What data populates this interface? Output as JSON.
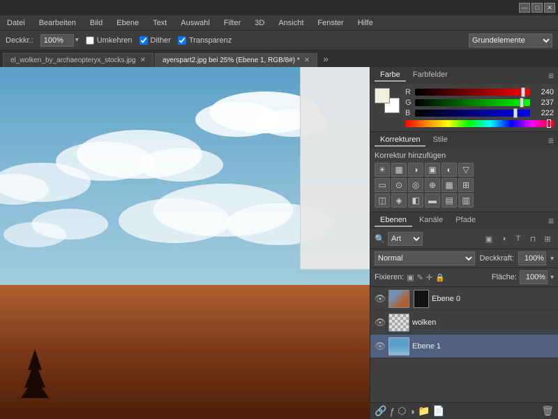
{
  "titlebar": {
    "buttons": [
      "—",
      "□",
      "✕"
    ]
  },
  "menubar": {
    "items": [
      "Datei",
      "Bearbeiten",
      "Bild",
      "Ebene",
      "Text",
      "Auswahl",
      "Filter",
      "3D",
      "Ansicht",
      "Fenster",
      "Hilfe"
    ]
  },
  "optionsbar": {
    "label": "Deckkr.:",
    "value": "100%",
    "checkboxes": [
      {
        "id": "umkehren",
        "label": "Umkehren",
        "checked": false
      },
      {
        "id": "dither",
        "label": "Dither",
        "checked": true
      },
      {
        "id": "transparenz",
        "label": "Transparenz",
        "checked": true
      }
    ],
    "dropdown": "Grundelemente"
  },
  "tabs": [
    {
      "label": "el_wolken_by_archaeopteryx_stocks.jpg",
      "active": false
    },
    {
      "label": "ayerspart2.jpg bei 25% (Ebene 1, RGB/8#)",
      "active": true
    },
    {
      "more": "»"
    }
  ],
  "color_panel": {
    "tab_active": "Farbe",
    "tab_inactive": "Farbfelder",
    "r_label": "R",
    "r_value": "240",
    "g_label": "G",
    "g_value": "237",
    "b_label": "B",
    "b_value": "222"
  },
  "corrections_panel": {
    "tab_active": "Korrekturen",
    "tab_inactive": "Stile",
    "title": "Korrektur hinzufügen",
    "icons_row1": [
      "☀",
      "▦",
      "◑",
      "▣",
      "◐",
      "▽"
    ],
    "icons_row2": [
      "▭",
      "⊙",
      "🔄",
      "⊕",
      "▦",
      "⊞"
    ],
    "icons_row3": [
      "◫",
      "◈",
      "◧",
      "▬",
      "▤",
      "▥"
    ]
  },
  "layers_panel": {
    "tab_active": "Ebenen",
    "tab_kanale": "Kanäle",
    "tab_pfade": "Pfade",
    "filter_placeholder": "Art",
    "blend_mode": "Normal",
    "opacity_label": "Deckkraft:",
    "opacity_value": "100%",
    "fixieren_label": "Fixieren:",
    "flaeche_label": "Fläche:",
    "flaeche_value": "100%",
    "layers": [
      {
        "name": "Ebene 0",
        "visible": true,
        "active": false,
        "has_mask": true
      },
      {
        "name": "wolken",
        "visible": true,
        "active": false,
        "has_mask": false,
        "checkered": true
      },
      {
        "name": "Ebene 1",
        "visible": true,
        "active": true,
        "has_mask": false,
        "blue_thumb": true
      }
    ]
  }
}
